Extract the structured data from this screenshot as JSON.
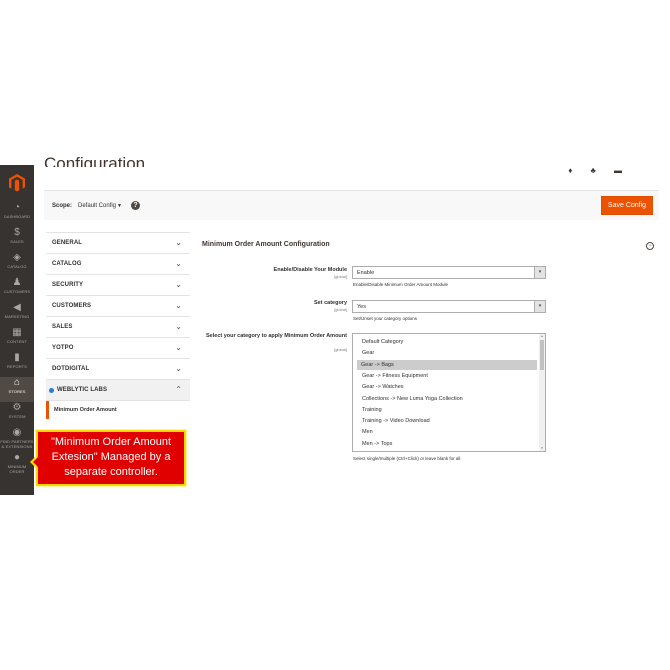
{
  "nav": {
    "items": [
      {
        "label": "DASHBOARD",
        "icon": "speedometer-icon",
        "glyph": "◔"
      },
      {
        "label": "SALES",
        "icon": "dollar-icon",
        "glyph": "$"
      },
      {
        "label": "CATALOG",
        "icon": "box-icon",
        "glyph": "◈"
      },
      {
        "label": "CUSTOMERS",
        "icon": "person-icon",
        "glyph": "♟"
      },
      {
        "label": "MARKETING",
        "icon": "megaphone-icon",
        "glyph": "◀"
      },
      {
        "label": "CONTENT",
        "icon": "layout-icon",
        "glyph": "▦"
      },
      {
        "label": "REPORTS",
        "icon": "bar-chart-icon",
        "glyph": "▮"
      },
      {
        "label": "STORES",
        "icon": "store-icon",
        "glyph": "⌂"
      },
      {
        "label": "SYSTEM",
        "icon": "gear-icon",
        "glyph": "⚙"
      },
      {
        "label": "FIND PARTNERS & EXTENSIONS",
        "icon": "cube-icon",
        "glyph": "◉"
      },
      {
        "label": "MINIMUM ORDER",
        "icon": "weblytic-icon",
        "glyph": "●"
      }
    ]
  },
  "page": {
    "title": "Configuration",
    "actions": "♦ ♣ ▬"
  },
  "scope": {
    "label": "Scope:",
    "value": "Default Config",
    "caret": "▼",
    "help": "?"
  },
  "toolbar": {
    "save_label": "Save Config"
  },
  "tabs": {
    "general": "GENERAL",
    "catalog": "CATALOG",
    "security": "SECURITY",
    "customers": "CUSTOMERS",
    "sales": "SALES",
    "yotpo": "YOTPO",
    "dotdigital": "DOTDIGITAL",
    "weblytic": "WEBLYTIC LABS",
    "sub_item": "Minimum Order Amount",
    "chev_down": "⌄",
    "chev_up": "⌃"
  },
  "section": {
    "title": "Minimum Order Amount Configuration",
    "collapse": "−"
  },
  "fields": {
    "enable": {
      "label": "Enable/Disable Your Module",
      "scope": "[global]",
      "value": "Enable",
      "note": "Enable/Disable Minimum Order Amount Module"
    },
    "category": {
      "label": "Set category",
      "scope": "[global]",
      "value": "Yes",
      "note": "Set/Unset your category options"
    },
    "apply": {
      "label": "Select your category to apply Minimum Order Amount",
      "scope": "[global]",
      "note": "Select single/multiple (Ctrl+Click) or leave blank for all",
      "options": [
        "Default Category",
        "Gear",
        "Gear -> Bags",
        "Gear -> Fitness Equipment",
        "Gear -> Watches",
        "Collections -> New Luma Yoga Collection",
        "Training",
        "Training -> Video Download",
        "Men",
        "Men -> Tops"
      ],
      "selected_index": 2
    },
    "arrow": "▾"
  },
  "callout": {
    "text": "\"Minimum Order Amount Extesion\" Managed by a separate controller."
  }
}
